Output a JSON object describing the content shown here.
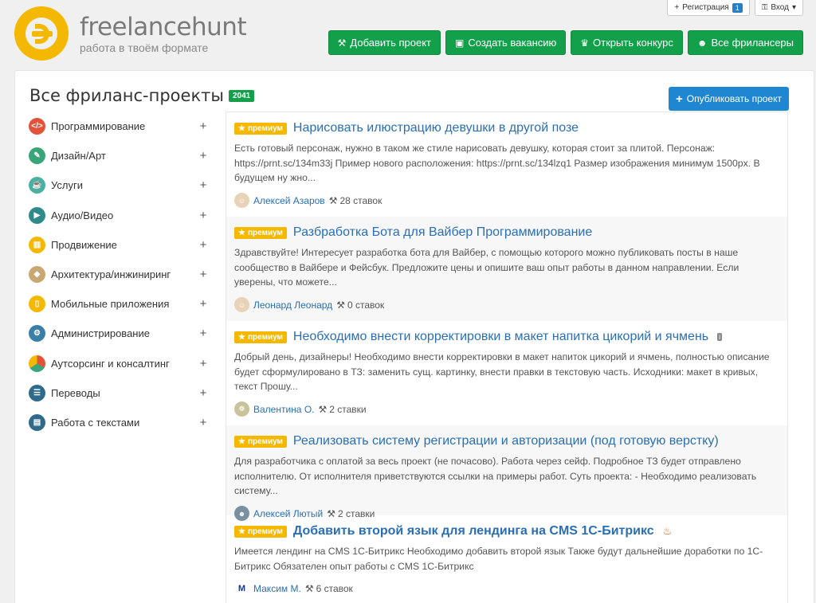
{
  "topbar": {
    "register_label": "Регистрация",
    "register_badge": "1",
    "login_label": "Вход"
  },
  "brand": {
    "name": "freelancehunt",
    "tagline": "работа в твоём формате",
    "color": "#f5b800"
  },
  "nav": [
    {
      "label": "Добавить проект",
      "icon": "gavel-icon"
    },
    {
      "label": "Создать вакансию",
      "icon": "briefcase-icon"
    },
    {
      "label": "Открыть конкурс",
      "icon": "trophy-icon"
    },
    {
      "label": "Все фрилансеры",
      "icon": "users-icon"
    }
  ],
  "page": {
    "title": "Все фриланс-проекты",
    "count": "2041",
    "publish_label": "Опубликовать проект"
  },
  "categories": [
    {
      "label": "Программирование",
      "icon": "code-icon",
      "color": "#e2533a"
    },
    {
      "label": "Дизайн/Арт",
      "icon": "palette-icon",
      "color": "#3aa57a"
    },
    {
      "label": "Услуги",
      "icon": "cup-icon",
      "color": "#4ab0a0"
    },
    {
      "label": "Аудио/Видео",
      "icon": "film-icon",
      "color": "#2f8a8a"
    },
    {
      "label": "Продвижение",
      "icon": "chart-icon",
      "color": "#f5b800"
    },
    {
      "label": "Архитектура/инжиниринг",
      "icon": "box-icon",
      "color": "#c8a870"
    },
    {
      "label": "Мобильные приложения",
      "icon": "phone-icon",
      "color": "#f5b800"
    },
    {
      "label": "Администрирование",
      "icon": "network-icon",
      "color": "#3a7fa8"
    },
    {
      "label": "Аутсорсинг и консалтинг",
      "icon": "pie-icon",
      "color": "#e2533a"
    },
    {
      "label": "Переводы",
      "icon": "book-icon",
      "color": "#2f6a8a"
    },
    {
      "label": "Работа с текстами",
      "icon": "document-icon",
      "color": "#2f6a8a"
    }
  ],
  "projects": [
    {
      "badge": "премиум",
      "title": "Нарисовать илюстрацию девушки в другой позе",
      "desc": "Есть готовый персонаж, нужно в таком же стиле нарисовать девушку, которая стоит за плитой. Персонаж: https://prnt.sc/134m33j Пример нового расположения: https://prnt.sc/134lzq1 Размер изображения минимум 1500px. В будущем ну жно...",
      "author": "Алексей Азаров",
      "bids": "28 ставок"
    },
    {
      "badge": "премиум",
      "title": "Разбработка Бота для Вайбер Программирование",
      "desc": "Здравствуйте! Интересует разработка бота для Вайбер, с помощью которого можно публиковать посты в наше сообщество в Вайбере и Фейсбук. Предложите цены и опишите ваш опыт работы в данном направлении. Если уверены, что можете...",
      "author": "Леонард Леонард",
      "bids": "0 ставок"
    },
    {
      "badge": "премиум",
      "title": "Необходимо внести корректировки в макет напитка цикорий и ячмень",
      "desc": "Добрый день, дизайнеры! Необходимо внести корректировки в макет напиток цикорий и ячмень, полностью описание будет сформулировано в ТЗ: заменить сущ. картинку, внести правки в текстовую часть. Исходники: макет в кривых, текст Прошу...",
      "author": "Валентина О.",
      "bids": "2 ставки"
    },
    {
      "badge": "премиум",
      "title": "Реализовать систему регистрации и авторизации (под готовую верстку)",
      "desc": "Для разработчика с оплатой за весь проект (не почасово). Работа через сейф. Подробное ТЗ будет отправлено исполнителю. От исполнителя приветствуются ссылки на примеры работ. Суть проекта: - Необходимо реализовать систему...",
      "author": "Алексей Лютый",
      "bids": "2 ставки"
    },
    {
      "badge": "премиум",
      "title": "Добавить второй язык для лендинга на CMS 1С-Битрикс",
      "desc": "Имеется лендинг на CMS 1С-Битрикс Необходимо добавить второй язык Также будут дальнейшие доработки по 1С-Битрикс Обязателен опыт работы с CMS 1С-Битрикс",
      "author": "Максим М.",
      "bids": "6 ставок"
    }
  ]
}
